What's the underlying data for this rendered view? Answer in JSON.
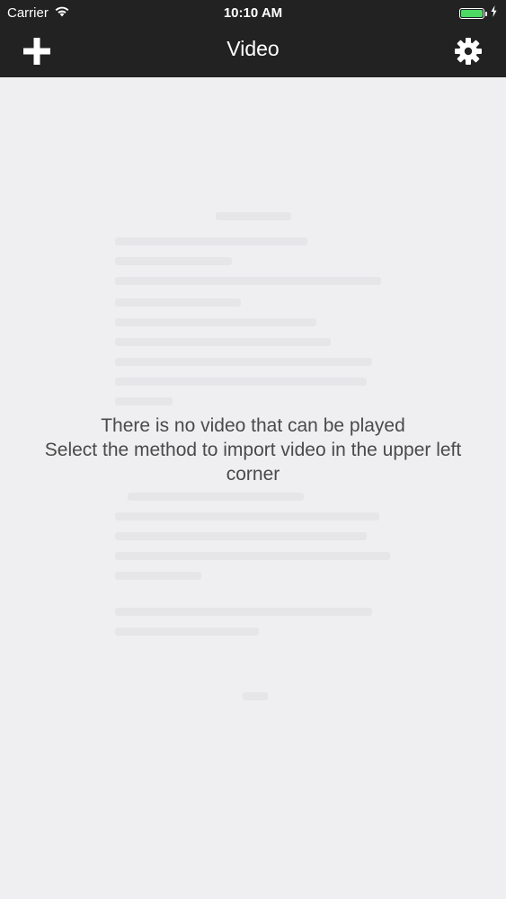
{
  "status_bar": {
    "carrier": "Carrier",
    "time": "10:10 AM",
    "battery_color": "#4cd964"
  },
  "nav_bar": {
    "title": "Video",
    "left_icon": "plus-icon",
    "right_icon": "gear-icon",
    "background": "#222222"
  },
  "empty_state": {
    "line1": "There is no video that can be played",
    "line2": "Select the method to import video in the upper left corner"
  }
}
